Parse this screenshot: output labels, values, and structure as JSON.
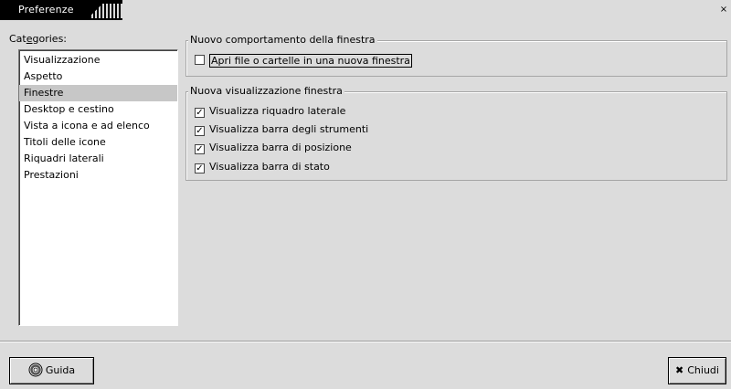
{
  "window": {
    "title": "Preferenze",
    "close_glyph": "×"
  },
  "categories": {
    "label": "Categories:",
    "items": [
      {
        "label": "Visualizzazione",
        "selected": false
      },
      {
        "label": "Aspetto",
        "selected": false
      },
      {
        "label": "Finestre",
        "selected": true
      },
      {
        "label": "Desktop e cestino",
        "selected": false
      },
      {
        "label": "Vista a icona e ad elenco",
        "selected": false
      },
      {
        "label": "Titoli delle icone",
        "selected": false
      },
      {
        "label": "Riquadri laterali",
        "selected": false
      },
      {
        "label": "Prestazioni",
        "selected": false
      }
    ]
  },
  "frame_behavior": {
    "legend": "Nuovo comportamento della finestra",
    "options": [
      {
        "label": "Apri file o cartelle in una nuova finestra",
        "checked": false
      }
    ]
  },
  "frame_display": {
    "legend": "Nuova visualizzazione finestra",
    "options": [
      {
        "label": "Visualizza riquadro laterale",
        "checked": true
      },
      {
        "label": "Visualizza barra degli strumenti",
        "checked": true
      },
      {
        "label": "Visualizza barra di posizione",
        "checked": true
      },
      {
        "label": "Visualizza barra di stato",
        "checked": true
      }
    ]
  },
  "buttons": {
    "help_label": "Guida",
    "close_label": "Chiudi",
    "close_glyph": "✖"
  },
  "check_glyph": "✓"
}
